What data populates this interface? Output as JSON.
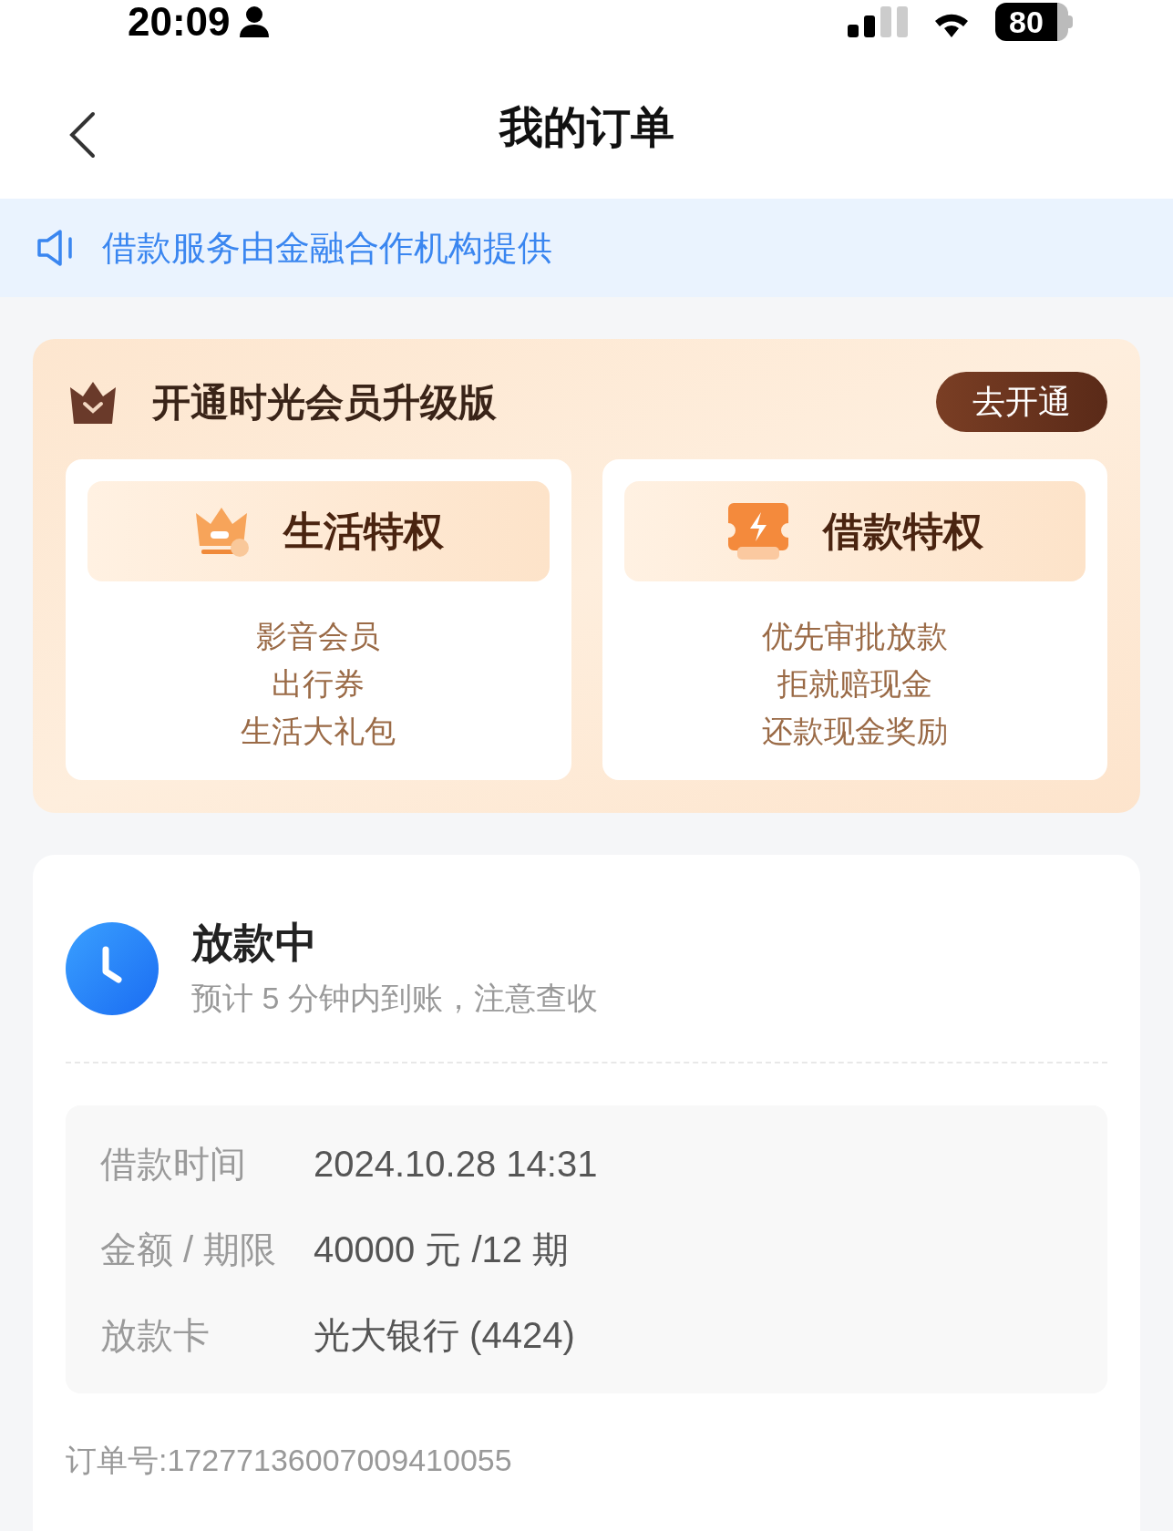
{
  "status_bar": {
    "time": "20:09",
    "battery": "80"
  },
  "header": {
    "title": "我的订单"
  },
  "notice": {
    "text": "借款服务由金融合作机构提供"
  },
  "membership": {
    "title": "开通时光会员升级版",
    "button": "去开通",
    "cards": [
      {
        "kind": "life",
        "title": "生活特权",
        "items": [
          "影音会员",
          "出行券",
          "生活大礼包"
        ]
      },
      {
        "kind": "loan",
        "title": "借款特权",
        "items": [
          "优先审批放款",
          "拒就赔现金",
          "还款现金奖励"
        ]
      }
    ]
  },
  "order": {
    "status": "放款中",
    "subtitle": "预计 5 分钟内到账，注意查收",
    "details": [
      {
        "label": "借款时间",
        "value": "2024.10.28 14:31"
      },
      {
        "label": "金额 / 期限",
        "value": "40000 元 /12 期"
      },
      {
        "label": "放款卡",
        "value": "光大银行 (4424)"
      }
    ],
    "order_number": "订单号:17277136007009410055"
  }
}
